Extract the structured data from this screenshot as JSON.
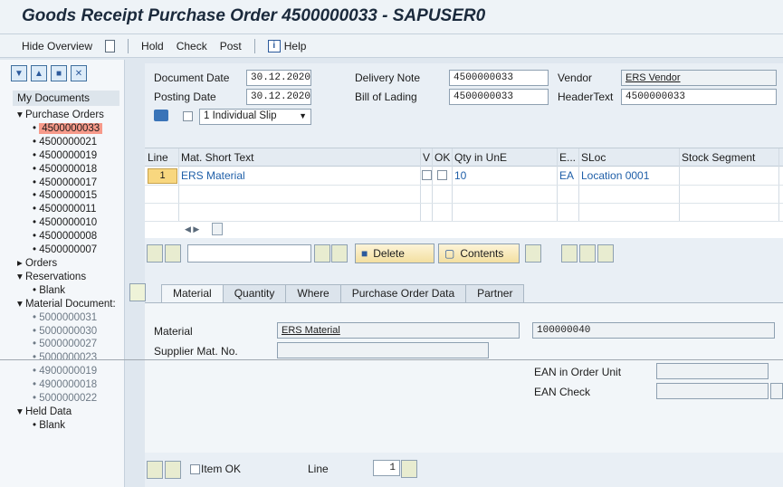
{
  "title": "Goods Receipt Purchase Order 4500000033 - SAPUSER0",
  "toolbar": {
    "hide_overview": "Hide Overview",
    "hold": "Hold",
    "check": "Check",
    "post": "Post",
    "help": "Help"
  },
  "sidebar": {
    "my_documents": "My Documents",
    "purchase_orders": "Purchase Orders",
    "po_items": [
      "4500000033",
      "4500000021",
      "4500000019",
      "4500000018",
      "4500000017",
      "4500000015",
      "4500000011",
      "4500000010",
      "4500000008",
      "4500000007"
    ],
    "orders": "Orders",
    "reservations": "Reservations",
    "res_blank": "Blank",
    "material_documents": "Material Document:",
    "md_items": [
      "5000000031",
      "5000000030",
      "5000000027",
      "5000000023",
      "4900000019",
      "4900000018",
      "5000000022"
    ],
    "held_data": "Held Data",
    "held_blank": "Blank"
  },
  "header": {
    "document_date_label": "Document Date",
    "document_date": "30.12.2020",
    "posting_date_label": "Posting Date",
    "posting_date": "30.12.2020",
    "delivery_note_label": "Delivery Note",
    "delivery_note": "4500000033",
    "bill_of_lading_label": "Bill of Lading",
    "bill_of_lading": "4500000033",
    "vendor_label": "Vendor",
    "vendor": "ERS Vendor",
    "header_text_label": "HeaderText",
    "header_text": "4500000033",
    "slip_option": "1 Individual Slip"
  },
  "table": {
    "headers": {
      "line": "Line",
      "mat_short_text": "Mat. Short Text",
      "v": "V",
      "ok": "OK",
      "qty": "Qty in UnE",
      "e": "E...",
      "sloc": "SLoc",
      "stock_segment": "Stock Segment"
    },
    "row": {
      "line": "1",
      "material": "ERS Material",
      "qty": "10",
      "unit": "EA",
      "sloc": "Location 0001"
    }
  },
  "buttons": {
    "delete": "Delete",
    "contents": "Contents"
  },
  "tabs": [
    "Material",
    "Quantity",
    "Where",
    "Purchase Order Data",
    "Partner"
  ],
  "detail": {
    "material_label": "Material",
    "material": "ERS Material",
    "material_no": "100000040",
    "supplier_mat_label": "Supplier Mat. No.",
    "ean_order_unit_label": "EAN in Order Unit",
    "ean_check_label": "EAN Check"
  },
  "footer": {
    "item_ok": "Item OK",
    "line_label": "Line",
    "line_value": "1"
  }
}
